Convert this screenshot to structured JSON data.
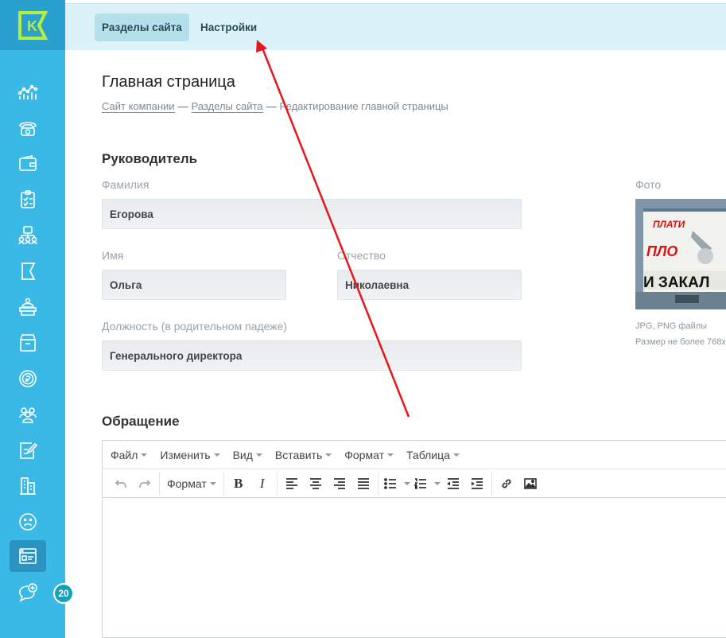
{
  "sidebar": {
    "logo_letter": "K",
    "items": [
      {
        "name": "analytics-icon"
      },
      {
        "name": "phone-icon"
      },
      {
        "name": "wallet-icon"
      },
      {
        "name": "clipboard-check-icon"
      },
      {
        "name": "org-structure-icon"
      },
      {
        "name": "flag-icon"
      },
      {
        "name": "reception-icon"
      },
      {
        "name": "archive-icon"
      },
      {
        "name": "coin-icon"
      },
      {
        "name": "people-icon"
      },
      {
        "name": "edit-note-icon"
      },
      {
        "name": "buildings-icon"
      },
      {
        "name": "sad-face-icon"
      },
      {
        "name": "website-icon",
        "active": true
      },
      {
        "name": "chat-add-icon"
      }
    ],
    "badge_count": "20"
  },
  "topnav": {
    "tabs": [
      {
        "label": "Разделы сайта",
        "active": true
      },
      {
        "label": "Настройки",
        "active": false
      }
    ]
  },
  "page": {
    "title": "Главная страница",
    "breadcrumb": {
      "item1": "Сайт компании",
      "item2": "Разделы сайта",
      "current": "Редактирование главной страницы",
      "separator": "—"
    }
  },
  "form": {
    "section_head": "Руководитель",
    "lastname_label": "Фамилия",
    "lastname_value": "Егорова",
    "firstname_label": "Имя",
    "firstname_value": "Ольга",
    "patronymic_label": "Отчество",
    "patronymic_value": "Николаевна",
    "position_label": "Должность (в родительном падеже)",
    "position_value": "Генерального директора",
    "photo_label": "Фото",
    "photo_hint1": "JPG, PNG файлы",
    "photo_hint2": "Размер не более 768x",
    "photo_text1": "ПЛАТИ",
    "photo_text2": "ПЛО",
    "photo_text3": "И ЗАКАЛ",
    "appeal_head": "Обращение"
  },
  "editor": {
    "menu": [
      "Файл",
      "Изменить",
      "Вид",
      "Вставить",
      "Формат",
      "Таблица"
    ],
    "format_label": "Формат"
  },
  "colors": {
    "sidebar": "#3ab8e6",
    "topbar": "#daf2f8",
    "annotation": "#e8151b"
  }
}
